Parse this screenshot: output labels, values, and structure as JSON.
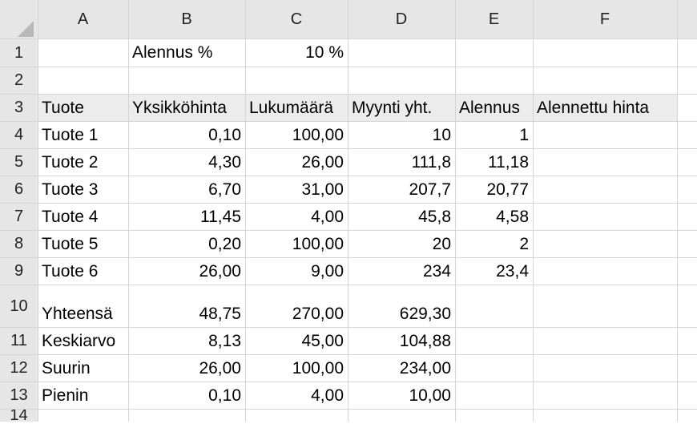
{
  "columns": [
    "A",
    "B",
    "C",
    "D",
    "E",
    "F"
  ],
  "rows": [
    "1",
    "2",
    "3",
    "4",
    "5",
    "6",
    "7",
    "8",
    "9",
    "10",
    "11",
    "12",
    "13",
    "14"
  ],
  "cells": {
    "B1": "Alennus %",
    "C1": "10 %",
    "A3": "Tuote",
    "B3": "Yksikköhinta",
    "C3": "Lukumäärä",
    "D3": "Myynti yht.",
    "E3": "Alennus",
    "F3": "Alennettu hinta",
    "A4": "Tuote 1",
    "B4": "0,10",
    "C4": "100,00",
    "D4": "10",
    "E4": "1",
    "A5": "Tuote 2",
    "B5": "4,30",
    "C5": "26,00",
    "D5": "111,8",
    "E5": "11,18",
    "A6": "Tuote 3",
    "B6": "6,70",
    "C6": "31,00",
    "D6": "207,7",
    "E6": "20,77",
    "A7": "Tuote 4",
    "B7": "11,45",
    "C7": "4,00",
    "D7": "45,8",
    "E7": "4,58",
    "A8": "Tuote 5",
    "B8": "0,20",
    "C8": "100,00",
    "D8": "20",
    "E8": "2",
    "A9": "Tuote 6",
    "B9": "26,00",
    "C9": "9,00",
    "D9": "234",
    "E9": "23,4",
    "A10": "Yhteensä",
    "B10": "48,75",
    "C10": "270,00",
    "D10": "629,30",
    "A11": "Keskiarvo",
    "B11": "8,13",
    "C11": "45,00",
    "D11": "104,88",
    "A12": "Suurin",
    "B12": "26,00",
    "C12": "100,00",
    "D12": "234,00",
    "A13": "Pienin",
    "B13": "0,10",
    "C13": "4,00",
    "D13": "10,00"
  },
  "colors": {
    "header_bg": "#e6e6e6",
    "band_bg": "#ececec",
    "gridline": "#d4d4d4"
  }
}
